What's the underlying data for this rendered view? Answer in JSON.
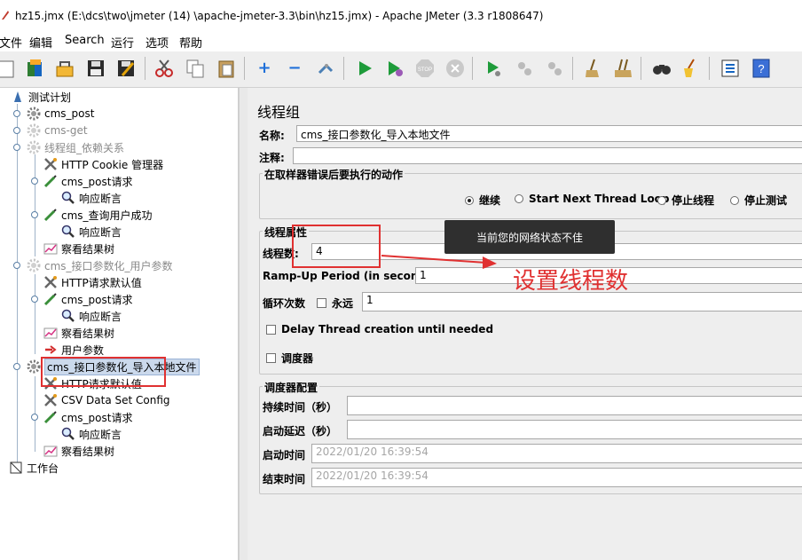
{
  "window": {
    "title": "hz15.jmx (E:\\dcs\\two\\jmeter  (14)  \\apache-jmeter-3.3\\bin\\hz15.jmx) - Apache JMeter (3.3 r1808647)"
  },
  "menu": [
    "文件",
    "编辑",
    "Search",
    "运行",
    "选项",
    "帮助"
  ],
  "toolbar": {
    "buttons": [
      "new-icon",
      "templates-icon",
      "open-icon",
      "save-icon",
      "save-as-icon",
      "cut-icon",
      "copy-icon",
      "paste-icon",
      "expand-icon",
      "collapse-icon",
      "toggle-icon",
      "start-icon",
      "start-no-pause-icon",
      "stop-icon",
      "shutdown-icon",
      "remote-start-icon",
      "remote-stop-icon",
      "remote-shutdown-icon",
      "clear-icon",
      "clear-all-icon",
      "search-icon",
      "reset-search-icon",
      "function-helper-icon",
      "help-icon"
    ]
  },
  "tree": {
    "nodes": [
      {
        "label": "测试计划",
        "icon": "test-plan-icon",
        "state": "normal"
      },
      {
        "label": "cms_post",
        "icon": "thread-group-icon",
        "state": "normal"
      },
      {
        "label": "cms-get",
        "icon": "thread-group-icon",
        "state": "disabled"
      },
      {
        "label": "线程组_依赖关系",
        "icon": "thread-group-icon",
        "state": "disabled"
      },
      {
        "label": "HTTP Cookie 管理器",
        "icon": "config-tool-icon",
        "state": "normal"
      },
      {
        "label": "cms_post请求",
        "icon": "sampler-pen-icon",
        "state": "normal"
      },
      {
        "label": "响应断言",
        "icon": "assertion-magnifier-icon",
        "state": "normal"
      },
      {
        "label": "cms_查询用户成功",
        "icon": "sampler-pen-icon",
        "state": "normal"
      },
      {
        "label": "响应断言",
        "icon": "assertion-magnifier-icon",
        "state": "normal"
      },
      {
        "label": "察看结果树",
        "icon": "listener-chart-icon",
        "state": "normal"
      },
      {
        "label": "cms_接口参数化_用户参数",
        "icon": "thread-group-icon",
        "state": "disabled"
      },
      {
        "label": "HTTP请求默认值",
        "icon": "config-tool-icon",
        "state": "normal"
      },
      {
        "label": "cms_post请求",
        "icon": "sampler-pen-icon",
        "state": "normal"
      },
      {
        "label": "响应断言",
        "icon": "assertion-magnifier-icon",
        "state": "normal"
      },
      {
        "label": "察看结果树",
        "icon": "listener-chart-icon",
        "state": "normal"
      },
      {
        "label": "用户参数",
        "icon": "preprocessor-arrow-icon",
        "state": "normal"
      },
      {
        "label": "cms_接口参数化_导入本地文件",
        "icon": "thread-group-icon",
        "state": "selected"
      },
      {
        "label": "HTTP请求默认值",
        "icon": "config-tool-icon",
        "state": "normal"
      },
      {
        "label": "CSV Data Set Config",
        "icon": "config-tool-icon",
        "state": "normal"
      },
      {
        "label": "cms_post请求",
        "icon": "sampler-pen-icon",
        "state": "normal"
      },
      {
        "label": "响应断言",
        "icon": "assertion-magnifier-icon",
        "state": "normal"
      },
      {
        "label": "察看结果树",
        "icon": "listener-chart-icon",
        "state": "normal"
      },
      {
        "label": "工作台",
        "icon": "workbench-icon",
        "state": "normal"
      }
    ]
  },
  "panel": {
    "title": "线程组",
    "name_label": "名称:",
    "name_value": "cms_接口参数化_导入本地文件",
    "comment_label": "注释:",
    "comment_value": "",
    "on_error": {
      "title": "在取样器错误后要执行的动作",
      "options": [
        "继续",
        "Start Next Thread Loop",
        "停止线程",
        "停止测试"
      ],
      "selected": "继续"
    },
    "thread_props": {
      "title": "线程属性",
      "threads_label": "线程数:",
      "threads_value": "4",
      "rampup_label": "Ramp-Up Period (in seconds):",
      "rampup_value": "1",
      "loop_label": "循环次数",
      "forever_label": "永远",
      "loop_value": "1",
      "delay_label": "Delay Thread creation until needed",
      "scheduler_label": "调度器"
    },
    "scheduler": {
      "title": "调度器配置",
      "duration_label": "持续时间（秒）",
      "duration_value": "",
      "delay_label": "启动延迟（秒）",
      "delay_value": "",
      "start_label": "启动时间",
      "start_value": "2022/01/20 16:39:54",
      "end_label": "结束时间",
      "end_value": "2022/01/20 16:39:54"
    }
  },
  "toast": "当前您的网络状态不佳",
  "annotation": "设置线程数",
  "colors": {
    "annotation_red": "#e03131",
    "selection_bg": "#cbd9ec",
    "toast_bg": "#2f2f2f"
  }
}
